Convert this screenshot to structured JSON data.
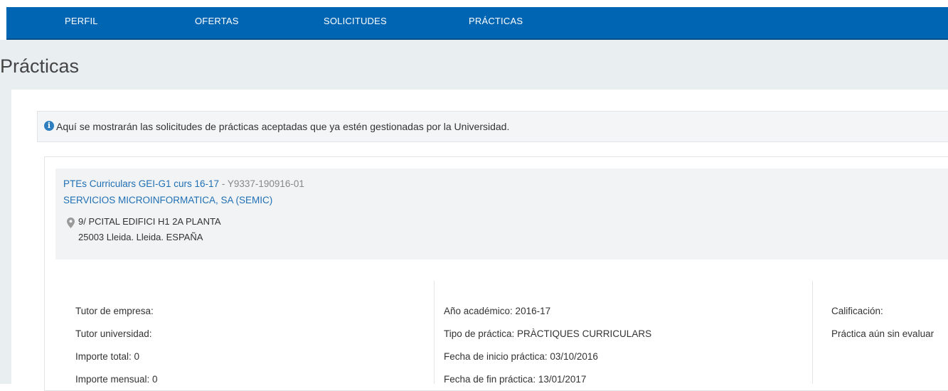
{
  "nav": {
    "tabs": [
      "PERFIL",
      "OFERTAS",
      "SOLICITUDES",
      "PRÁCTICAS"
    ]
  },
  "page": {
    "title": "Prácticas"
  },
  "info": {
    "icon": "info-icon",
    "message": "Aquí se mostrarán las solicitudes de prácticas aceptadas que ya estén gestionadas por la Universidad."
  },
  "practice": {
    "program": "PTEs Curriculars GEI-G1 curs 16-17",
    "code": " - Y9337-190916-01",
    "company": "SERVICIOS MICROINFORMATICA, SA (SEMIC)",
    "address_line1": "9/ PCITAL EDIFICI H1 2A PLANTA",
    "address_line2": "25003 Lleida. Lleida. ESPAÑA",
    "col1": [
      "Tutor de empresa:",
      "Tutor universidad:",
      "Importe total: 0",
      "Importe mensual: 0"
    ],
    "col2": [
      "Año académico: 2016-17",
      "Tipo de práctica: PRÀCTIQUES CURRICULARS",
      "Fecha de inicio práctica: 03/10/2016",
      "Fecha de fin práctica: 13/01/2017"
    ],
    "col3": [
      "Calificación:",
      "Práctica aún sin evaluar"
    ]
  },
  "colors": {
    "nav_bg": "#0066b3",
    "link": "#1f6fb5",
    "band": "#e9eef1"
  }
}
